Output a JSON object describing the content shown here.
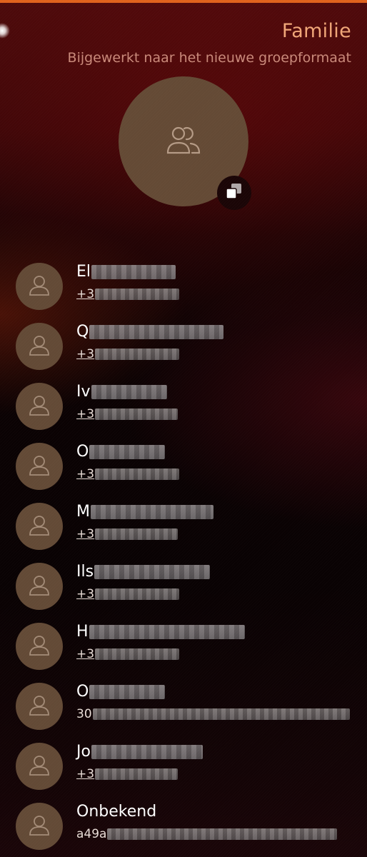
{
  "header": {
    "title": "Familie",
    "subtitle": "Bijgewerkt naar het nieuwe groepformaat"
  },
  "group": {
    "avatar_icon": "group-icon",
    "copy_icon": "copy-icon"
  },
  "colors": {
    "accent": "#e0621c",
    "title": "#f0a678",
    "avatar_bg": "#644a35"
  },
  "members": [
    {
      "name": "El",
      "number": "+3",
      "number_linked": true
    },
    {
      "name": "Q",
      "number": "+3",
      "number_linked": true
    },
    {
      "name": "Iv",
      "number": "+3",
      "number_linked": true
    },
    {
      "name": "O",
      "number": "+3",
      "number_linked": true
    },
    {
      "name": "M",
      "number": "+3",
      "number_linked": true
    },
    {
      "name": "Ils",
      "number": "+3",
      "number_linked": true
    },
    {
      "name": "H",
      "number": "+3",
      "number_linked": true
    },
    {
      "name": "O",
      "number": "30",
      "number_linked": false
    },
    {
      "name": "Jo",
      "number": "+3",
      "number_linked": true
    },
    {
      "name": "Onbekend",
      "number": "a49a",
      "number_linked": false
    }
  ]
}
